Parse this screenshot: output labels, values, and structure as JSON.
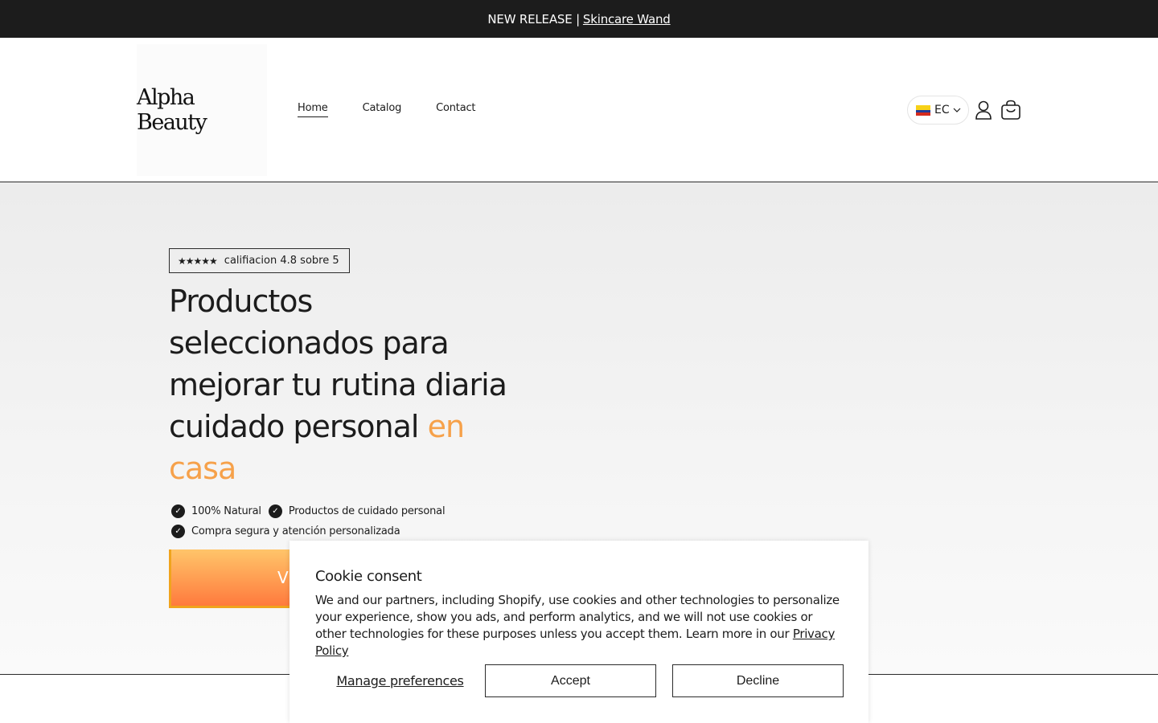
{
  "announcement": {
    "prefix": "NEW RELEASE |",
    "link_label": "Skincare Wand"
  },
  "header": {
    "logo_text": "Alpha Beauty",
    "nav": [
      {
        "label": "Home",
        "active": true
      },
      {
        "label": "Catalog",
        "active": false
      },
      {
        "label": "Contact",
        "active": false
      }
    ],
    "country_code": "EC",
    "icons": [
      "user-icon",
      "cart-icon",
      "chevron-down-icon"
    ]
  },
  "hero": {
    "stars": "★★★★★",
    "rating_text": "califiacion 4.8 sobre 5",
    "headline_main": "Productos seleccionados para mejorar tu rutina diaria cuidado personal",
    "headline_accent": "en casa",
    "features": [
      "100% Natural",
      "Productos de cuidado personal",
      "Compra segura y atención personalizada"
    ],
    "cta_label_visible": "V"
  },
  "cookie": {
    "title": "Cookie consent",
    "body": "We and our partners, including Shopify, use cookies and other technologies to personalize your experience, show you ads, and perform analytics, and we will not use cookies or other technologies for these purposes unless you accept them. Learn more in our",
    "policy_link": "Privacy Policy",
    "manage_label": "Manage preferences",
    "accept_label": "Accept",
    "decline_label": "Decline"
  },
  "colors": {
    "accent": "#f6a14a",
    "dark": "#1c1c1c",
    "cta_top": "#ffc56a",
    "cta_bottom": "#ff7a3d"
  }
}
